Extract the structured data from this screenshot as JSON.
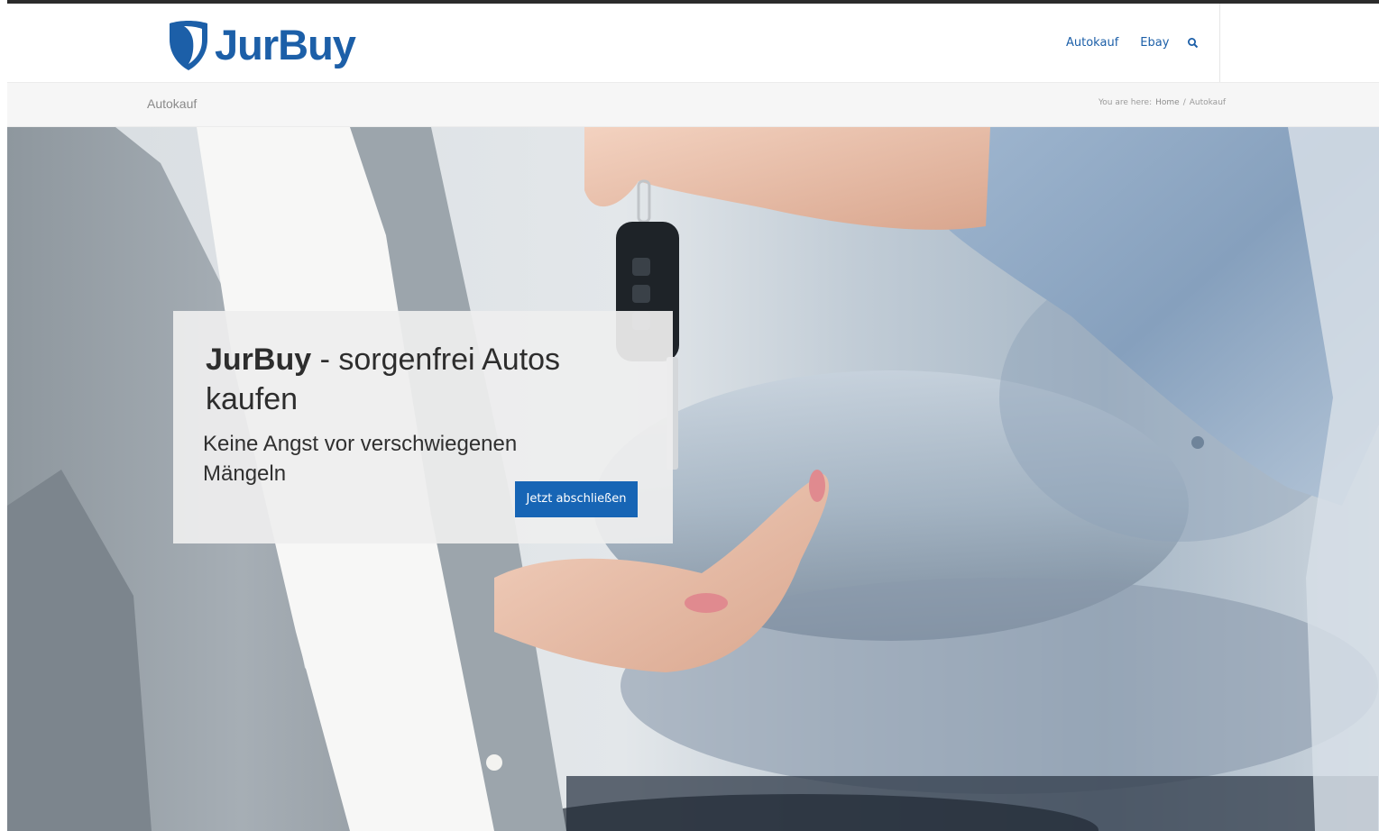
{
  "brand": {
    "name": "JurBuy",
    "logo_color": "#1c5fa8"
  },
  "nav": {
    "items": [
      {
        "label": "Autokauf"
      },
      {
        "label": "Ebay"
      }
    ],
    "search_icon": "search-icon"
  },
  "titlebar": {
    "title": "Autokauf",
    "breadcrumb": {
      "prefix": "You are here:",
      "home": "Home",
      "separator": "/",
      "current": "Autokauf"
    }
  },
  "hero": {
    "headline_brand": "JurBuy",
    "headline_rest": " - sorgenfrei Autos kaufen",
    "subline": "Keine Angst vor verschwiegenen Mängeln",
    "cta_label": "Jetzt abschließen",
    "cta_color": "#1765b5",
    "image_subject": "car-key-handover-photo"
  }
}
